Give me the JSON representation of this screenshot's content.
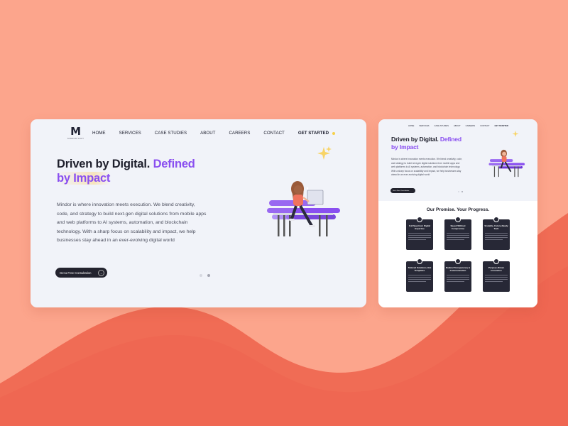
{
  "colors": {
    "background": "#fca58c",
    "wave": "#f06c55",
    "accent": "#8a4ff0",
    "dark": "#23232e",
    "card_bg": "#f1f3f9"
  },
  "main": {
    "logo": {
      "mark": "M",
      "tagline": "MINDOR SOFT"
    },
    "nav": {
      "home": "HOME",
      "services": "SERVICES",
      "case_studies": "CASE STUDIES",
      "about": "ABOUT",
      "careers": "CAREERS",
      "contact": "CONTACT",
      "get_started": "GET STARTED"
    },
    "hero": {
      "title_part1": "Driven by Digital.",
      "title_accent1": "Defined",
      "title_accent2": "by Impact",
      "description": "Mindor is where innovation meets execution. We blend creativity, code, and strategy to build next-gen digital solutions from mobile apps and web platforms to AI systems, automation, and blockchain technology. With a sharp focus on scalability and impact, we help businesses stay ahead in an ever-evolving digital world",
      "cta_label": "Get a Free Consultation",
      "cta_icon": "arrow-right-icon"
    },
    "slider": {
      "count": 2,
      "active": 2
    }
  },
  "preview": {
    "nav": {
      "home": "HOME",
      "services": "SERVICES",
      "case_studies": "CASE STUDIES",
      "about": "ABOUT",
      "careers": "CAREERS",
      "contact": "CONTACT",
      "get_started": "GET STARTED"
    },
    "hero": {
      "title_part1": "Driven by Digital.",
      "title_accent1": "Defined",
      "title_accent2": "by Impact",
      "description": "Mindor is where innovation meets execution. We blend creativity, code, and strategy to build next-gen digital solutions from mobile apps and web platforms to AI systems, automation, and blockchain technology. With a sharp focus on scalability and impact, we help businesses stay ahead in an ever-evolving digital world",
      "cta_label": "Get a Free Consultation"
    },
    "promise": {
      "title": "Our Promise. Your Progress.",
      "cards": [
        {
          "title": "Full Spectrum Digital Expertise"
        },
        {
          "title": "Speed Without Compromise"
        },
        {
          "title": "Scalable, Future-Ready Tech"
        },
        {
          "title": "Tailored Solutions, Not Templates"
        },
        {
          "title": "Radical Transparency & Communication"
        },
        {
          "title": "Purpose-Driven Innovation"
        }
      ]
    }
  }
}
